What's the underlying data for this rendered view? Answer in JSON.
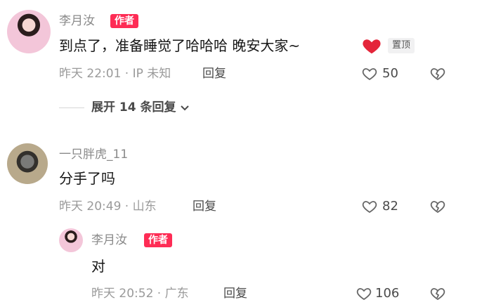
{
  "comments": [
    {
      "username": "李月汝",
      "badge": "作者",
      "content": "到点了，准备睡觉了哈哈哈 晚安大家~",
      "pinned_label": "置顶",
      "meta": "昨天 22:01 · IP 未知",
      "reply_label": "回复",
      "likes": "50"
    },
    {
      "username": "一只胖虎_11",
      "content": "分手了吗",
      "meta": "昨天 20:49 · 山东",
      "reply_label": "回复",
      "likes": "82"
    },
    {
      "username": "李月汝",
      "badge": "作者",
      "content": "对",
      "meta": "昨天 20:52 · 广东",
      "reply_label": "回复",
      "likes": "106"
    }
  ],
  "expand_replies": "展开 14 条回复",
  "colors": {
    "badge": "#fe2c55",
    "heart": "#fe2c55"
  },
  "icons": {
    "like": "heart-outline-icon",
    "dislike": "broken-heart-icon",
    "expand": "chevron-down-icon",
    "emoji": "red-heart-emoji"
  }
}
